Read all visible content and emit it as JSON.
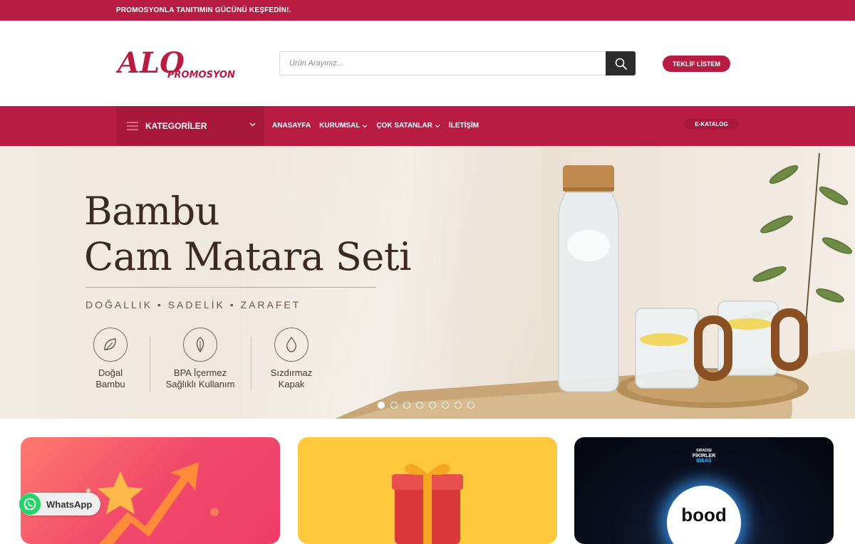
{
  "topbar": {
    "promo": "PROMOSYONLA TANITIMIN GÜCÜNÜ KEŞFEDİN!."
  },
  "header": {
    "logo_text": "ALO",
    "logo_sub": "PROMOSYON",
    "search": {
      "placeholder": "Ürün Arayınız..."
    },
    "teklif_label": "TEKLİF LİSTEM"
  },
  "nav": {
    "categories_label": "KATEGORİLER",
    "items": [
      {
        "label": "ANASAYFA",
        "dropdown": false
      },
      {
        "label": "KURUMSAL",
        "dropdown": true
      },
      {
        "label": "ÇOK SATANLAR",
        "dropdown": true
      },
      {
        "label": "İLETİŞİM",
        "dropdown": false
      }
    ],
    "ekatalog_label": "E-KATALOG"
  },
  "hero": {
    "title_line1": "Bambu",
    "title_line2": "Cam Matara Seti",
    "subtitle": "DOĞALLIK • SADELİK • ZARAFET",
    "features": [
      {
        "icon": "leaf-icon",
        "line1": "Doğal",
        "line2": "Bambu"
      },
      {
        "icon": "leaf-outline-icon",
        "line1": "BPA İçermez",
        "line2": "Sağlıklı Kullanım"
      },
      {
        "icon": "drop-icon",
        "line1": "Sızdırmaz",
        "line2": "Kapak"
      }
    ],
    "slides_total": 8,
    "active_slide": 1
  },
  "cards": [
    {
      "theme": "growth"
    },
    {
      "theme": "gift"
    },
    {
      "badge_line1": "SIRADIŞI",
      "badge_line2": "FİKİRLER",
      "badge_line3": "IDEAS",
      "brand": "bood"
    }
  ],
  "whatsapp": {
    "label": "WhatsApp"
  },
  "colors": {
    "brand": "#b91c43",
    "brand_dark": "#a7183b",
    "search_button": "#2b2b2b",
    "whatsapp": "#25d366"
  }
}
